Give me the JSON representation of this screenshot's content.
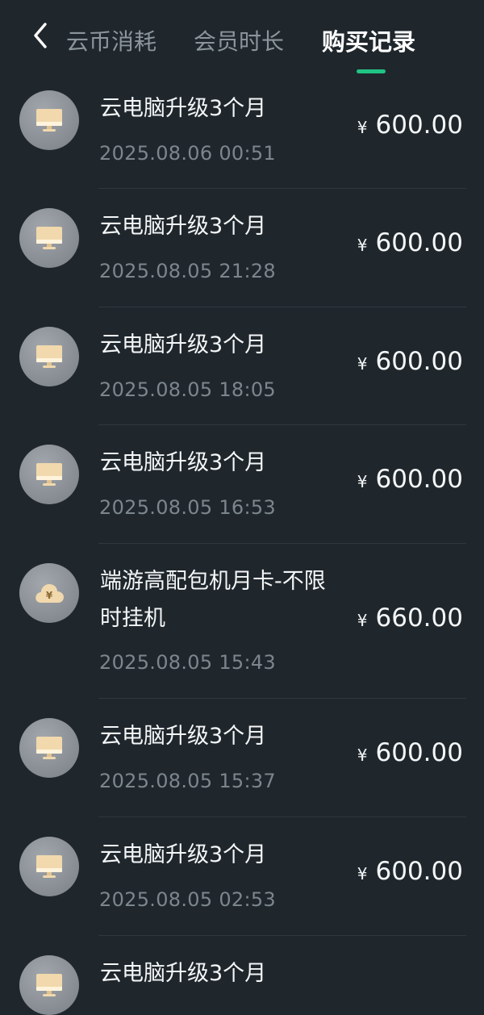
{
  "header": {
    "back_icon": "chevron-left-icon",
    "tabs": [
      {
        "label": "云币消耗",
        "active": false
      },
      {
        "label": "会员时长",
        "active": false
      },
      {
        "label": "购买记录",
        "active": true
      }
    ],
    "indicator_color": "#20c484"
  },
  "records": [
    {
      "icon": "monitor-icon",
      "title": "云电脑升级3个月",
      "date": "2025.08.06 00:51",
      "currency": "¥",
      "amount": "600.00"
    },
    {
      "icon": "monitor-icon",
      "title": "云电脑升级3个月",
      "date": "2025.08.05 21:28",
      "currency": "¥",
      "amount": "600.00"
    },
    {
      "icon": "monitor-icon",
      "title": "云电脑升级3个月",
      "date": "2025.08.05 18:05",
      "currency": "¥",
      "amount": "600.00"
    },
    {
      "icon": "monitor-icon",
      "title": "云电脑升级3个月",
      "date": "2025.08.05 16:53",
      "currency": "¥",
      "amount": "600.00"
    },
    {
      "icon": "cloud-yen-icon",
      "title": "端游高配包机月卡-不限时挂机",
      "date": "2025.08.05 15:43",
      "currency": "¥",
      "amount": "660.00"
    },
    {
      "icon": "monitor-icon",
      "title": "云电脑升级3个月",
      "date": "2025.08.05 15:37",
      "currency": "¥",
      "amount": "600.00"
    },
    {
      "icon": "monitor-icon",
      "title": "云电脑升级3个月",
      "date": "2025.08.05 02:53",
      "currency": "¥",
      "amount": "600.00"
    },
    {
      "icon": "monitor-icon",
      "title": "云电脑升级3个月",
      "date": "",
      "currency": "",
      "amount": ""
    }
  ]
}
